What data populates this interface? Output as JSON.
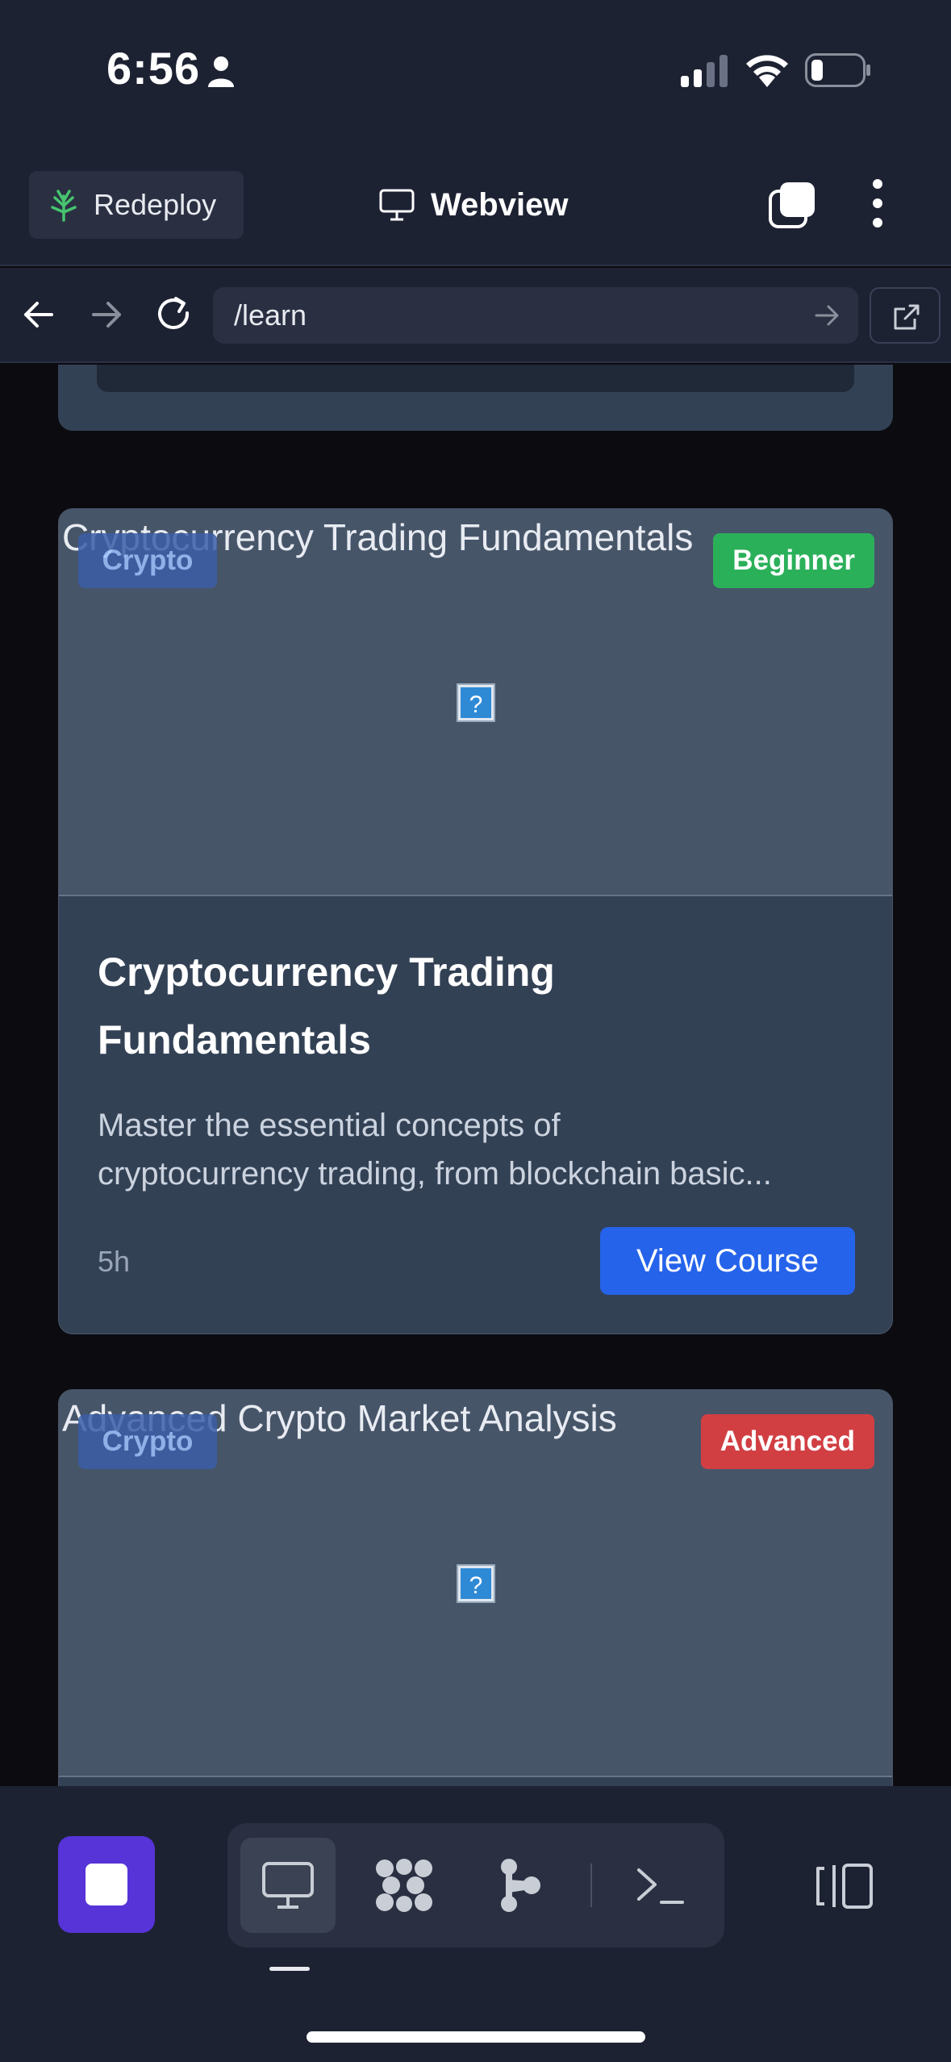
{
  "status_bar": {
    "time": "6:56"
  },
  "header": {
    "redeploy_label": "Redeploy",
    "title": "Webview"
  },
  "url_bar": {
    "value": "/learn"
  },
  "courses": [
    {
      "alt_text": "Cryptocurrency Trading Fundamentals",
      "category": "Crypto",
      "level": "Beginner",
      "level_color": "#2bb05a",
      "title_line1": "Cryptocurrency Trading",
      "title_line2": "Fundamentals",
      "desc_line1": "Master the essential concepts of",
      "desc_line2": "cryptocurrency trading, from blockchain basic...",
      "duration": "5h",
      "button_label": "View Course"
    },
    {
      "alt_text": "Advanced Crypto Market Analysis",
      "category": "Crypto",
      "level": "Advanced",
      "level_color": "#d13f43"
    }
  ],
  "colors": {
    "accent": "#2563eb",
    "stop_button": "#5634d8"
  },
  "icons": {
    "toolbar": [
      "desktop-icon",
      "grid-icon",
      "branch-icon",
      "terminal-icon"
    ]
  }
}
